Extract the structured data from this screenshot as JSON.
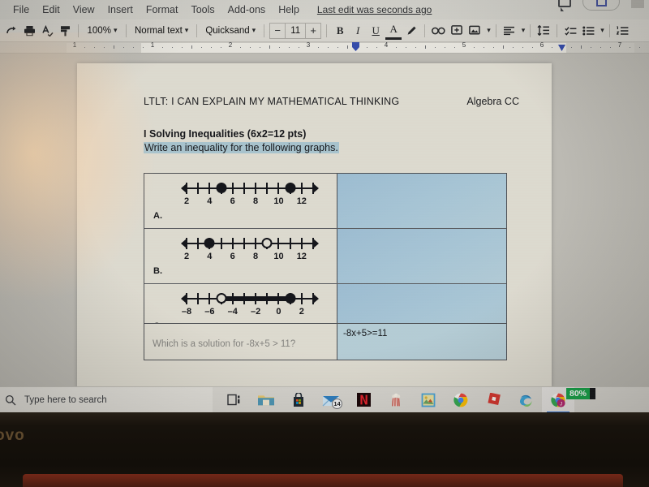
{
  "app": {
    "menu": [
      "File",
      "Edit",
      "View",
      "Insert",
      "Format",
      "Tools",
      "Add-ons",
      "Help"
    ],
    "last_edit": "Last edit was seconds ago"
  },
  "toolbar": {
    "redo_icon": "redo-icon",
    "print_icon": "print-icon",
    "spellcheck_icon": "spellcheck-icon",
    "paint_format_icon": "paint-format-icon",
    "zoom": "100%",
    "style": "Normal text",
    "font": "Quicksand",
    "font_size": "11",
    "decrease_label": "−",
    "increase_label": "+",
    "bold_label": "B",
    "italic_label": "I",
    "underline_label": "U",
    "text_color_label": "A",
    "highlight_icon": "highlight-pen-icon",
    "link_icon": "insert-link-icon",
    "comment_icon": "add-comment-icon",
    "image_icon": "insert-image-icon",
    "align_icon": "align-left-icon",
    "line_spacing_icon": "line-spacing-icon",
    "checklist_icon": "checklist-icon",
    "bulleted_list_icon": "bulleted-list-icon",
    "numbered_list_icon": "numbered-list-icon",
    "dropdown_caret": "▾"
  },
  "topright": {
    "comment_icon": "comment-history-icon",
    "share_icon": "share-button-icon"
  },
  "ruler": {
    "numbers": [
      1,
      1,
      2,
      3,
      4,
      5,
      6,
      7
    ],
    "left_indent_marker": "indent-marker",
    "right_indent_marker": "right-indent-marker"
  },
  "document": {
    "header_title": "LTLT:  I CAN EXPLAIN MY MATHEMATICAL THINKING",
    "header_right": "Algebra CC",
    "section_title": "I Solving Inequalities (6x2=12 pts)",
    "section_instruction": "Write an inequality for the following graphs.",
    "highlight_color": "#a8c4ce",
    "answer_cell_color": "#a8c6d6",
    "table": {
      "rows": [
        {
          "label": "A.",
          "graph": {
            "ticks": [
              2,
              3,
              4,
              5,
              6,
              7,
              8,
              9,
              10,
              11,
              12,
              13
            ],
            "labels": [
              "2",
              "4",
              "6",
              "8",
              "10",
              "12"
            ],
            "label_values": [
              2,
              4,
              6,
              8,
              10,
              12
            ],
            "points": [
              {
                "value": 5,
                "type": "closed"
              },
              {
                "value": 11,
                "type": "closed"
              }
            ],
            "segments": []
          },
          "answer": ""
        },
        {
          "label": "B.",
          "graph": {
            "ticks": [
              2,
              3,
              4,
              5,
              6,
              7,
              8,
              9,
              10,
              11,
              12,
              13
            ],
            "labels": [
              "2",
              "4",
              "6",
              "8",
              "10",
              "12"
            ],
            "label_values": [
              2,
              4,
              6,
              8,
              10,
              12
            ],
            "points": [
              {
                "value": 4,
                "type": "closed"
              },
              {
                "value": 9,
                "type": "open"
              }
            ],
            "segments": []
          },
          "answer": ""
        },
        {
          "label": "C.",
          "graph": {
            "ticks": [
              -8,
              -7,
              -6,
              -5,
              -4,
              -3,
              -2,
              -1,
              0,
              1,
              2,
              3
            ],
            "labels": [
              "–8",
              "–6",
              "–4",
              "–2",
              "0",
              "2"
            ],
            "label_values": [
              -8,
              -6,
              -4,
              -2,
              0,
              2
            ],
            "points": [
              {
                "value": -5,
                "type": "open"
              },
              {
                "value": 1,
                "type": "closed"
              }
            ],
            "segments": [
              {
                "from": -5,
                "to": 1
              }
            ]
          },
          "answer": ""
        }
      ]
    },
    "next_row": {
      "question": "Which is a solution for -8x+5 > 11?",
      "answer": "-8x+5>=11"
    }
  },
  "taskbar": {
    "search_placeholder": "Type here to search",
    "search_icon": "search-icon",
    "items": [
      {
        "name": "task-view-icon",
        "label": ""
      },
      {
        "name": "file-explorer-icon",
        "label": ""
      },
      {
        "name": "microsoft-store-icon",
        "label": ""
      },
      {
        "name": "mail-icon",
        "label": "",
        "badge": "14"
      },
      {
        "name": "netflix-icon",
        "label": "N"
      },
      {
        "name": "popcorn-app-icon",
        "label": ""
      },
      {
        "name": "photos-app-icon",
        "label": ""
      },
      {
        "name": "chrome-icon",
        "label": ""
      },
      {
        "name": "roblox-icon",
        "label": ""
      },
      {
        "name": "microsoft-edge-icon",
        "label": ""
      },
      {
        "name": "chrome-profile-icon",
        "label": "J"
      }
    ],
    "battery_percent": "80%",
    "battery_color": "#18a34a"
  },
  "device": {
    "brand": "ovo"
  }
}
